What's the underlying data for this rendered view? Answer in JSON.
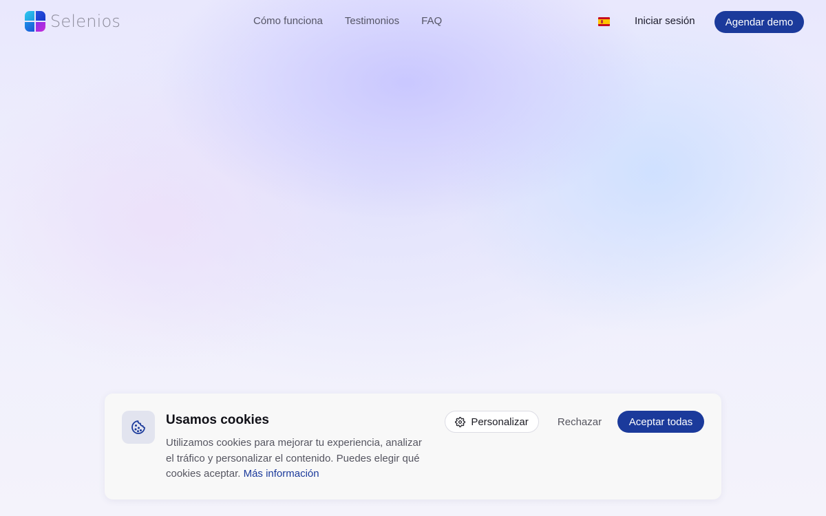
{
  "brand": {
    "name": "Selenios",
    "logo_icon": "selenios-logo-icon",
    "colors": [
      "#2fb5f0",
      "#1546d8",
      "#c02be0",
      "#7a2ee0"
    ]
  },
  "nav": {
    "items": [
      {
        "label": "Cómo funciona"
      },
      {
        "label": "Testimonios"
      },
      {
        "label": "FAQ"
      }
    ]
  },
  "header": {
    "language_icon": "spain-flag-icon",
    "login_label": "Iniciar sesión",
    "demo_label": "Agendar demo"
  },
  "cookie_banner": {
    "icon": "cookie-icon",
    "title": "Usamos cookies",
    "text": "Utilizamos cookies para mejorar tu experiencia, analizar el tráfico y personalizar el contenido. Puedes elegir qué cookies aceptar.",
    "link_label": "Más información",
    "personalize_icon": "gear-icon",
    "personalize_label": "Personalizar",
    "reject_label": "Rechazar",
    "accept_label": "Aceptar todas"
  },
  "theme": {
    "accent": "#1b3a9b"
  }
}
